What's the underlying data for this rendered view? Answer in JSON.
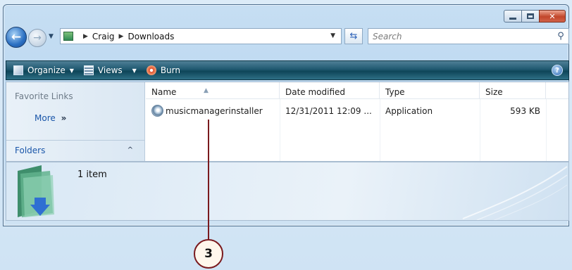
{
  "window": {
    "title_buttons": {
      "minimize_icon": "minimize-icon",
      "maximize_icon": "maximize-icon",
      "close_icon": "close-icon"
    }
  },
  "address": {
    "crumbs": [
      "Craig",
      "Downloads"
    ],
    "search_placeholder": "Search"
  },
  "toolbar": {
    "organize_label": "Organize",
    "views_label": "Views",
    "burn_label": "Burn",
    "help_label": "?"
  },
  "nav_pane": {
    "favorite_links_title": "Favorite Links",
    "more_label": "More",
    "more_chevron": "»",
    "folders_label": "Folders",
    "folders_chevron": "^"
  },
  "file_list": {
    "columns": [
      "Name",
      "Date modified",
      "Type",
      "Size"
    ],
    "rows": [
      {
        "name": "musicmanagerinstaller",
        "date_modified": "12/31/2011 12:09 ...",
        "type": "Application",
        "size": "593 KB"
      }
    ]
  },
  "details_pane": {
    "item_count": "1 item"
  },
  "callout": {
    "number": "3",
    "color": "#7a1a1e"
  },
  "colors": {
    "command_bar": "#1f5870",
    "link_blue": "#1a56a9"
  }
}
